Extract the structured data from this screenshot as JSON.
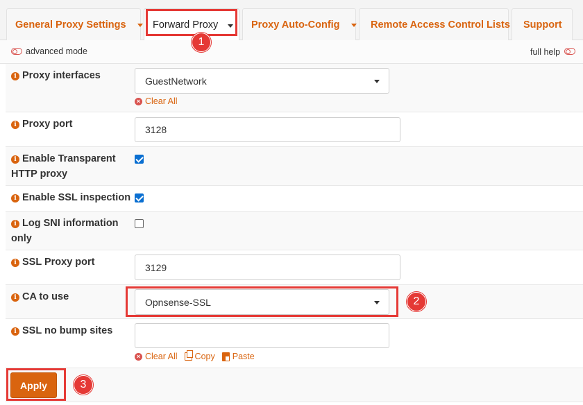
{
  "tabs": [
    {
      "label": "General Proxy Settings",
      "has_dropdown": true,
      "active": false
    },
    {
      "label": "Forward Proxy",
      "has_dropdown": true,
      "active": true
    },
    {
      "label": "Proxy Auto-Config",
      "has_dropdown": true,
      "active": false
    },
    {
      "label": "Remote Access Control Lists",
      "has_dropdown": false,
      "active": false
    },
    {
      "label": "Support",
      "has_dropdown": false,
      "active": false
    }
  ],
  "modebar": {
    "advanced_mode_label": "advanced mode",
    "full_help_label": "full help",
    "toggle_icon": "toggle-off-icon"
  },
  "fields": {
    "proxy_interfaces": {
      "label": "Proxy interfaces",
      "value": "GuestNetwork",
      "clear_all": "Clear All"
    },
    "proxy_port": {
      "label": "Proxy port",
      "value": "3128"
    },
    "transparent_http": {
      "label_line1": "Enable Transparent",
      "label_line2": "HTTP proxy",
      "checked": true
    },
    "ssl_inspection": {
      "label": "Enable SSL inspection",
      "checked": true
    },
    "log_sni": {
      "label_line1": "Log SNI information",
      "label_line2": "only",
      "checked": false
    },
    "ssl_proxy_port": {
      "label": "SSL Proxy port",
      "value": "3129"
    },
    "ca_to_use": {
      "label": "CA to use",
      "value": "Opnsense-SSL"
    },
    "ssl_no_bump": {
      "label": "SSL no bump sites",
      "value": "",
      "clear_all": "Clear All",
      "copy": "Copy",
      "paste": "Paste"
    }
  },
  "info_icon": "i",
  "apply_label": "Apply",
  "callouts": [
    "1",
    "2",
    "3"
  ],
  "colors": {
    "accent": "#d9640f",
    "highlight": "#e53935",
    "checkbox": "#0a6fd1"
  }
}
